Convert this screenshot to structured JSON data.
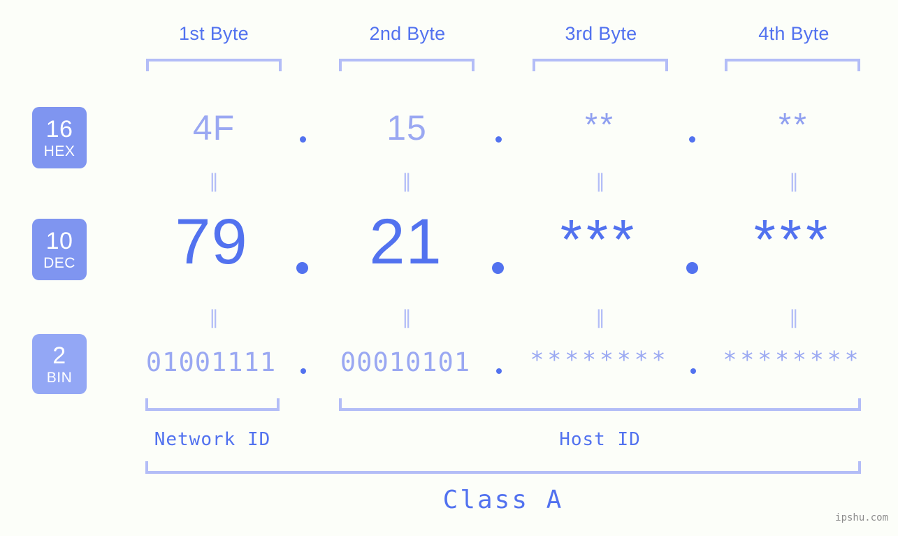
{
  "page": {
    "background": "#fcfef9",
    "accent_strong": "#5272ef",
    "accent_light": "#9aa8f2",
    "accent_pale": "#b3bdf7",
    "watermark": "ipshu.com"
  },
  "columns": [
    {
      "header": "1st Byte"
    },
    {
      "header": "2nd Byte"
    },
    {
      "header": "3rd Byte"
    },
    {
      "header": "4th Byte"
    }
  ],
  "bases": [
    {
      "number": "16",
      "name": "HEX",
      "color": "#7f95f0"
    },
    {
      "number": "10",
      "name": "DEC",
      "color": "#7f95f0"
    },
    {
      "number": "2",
      "name": "BIN",
      "color": "#93a7f5"
    }
  ],
  "rows": {
    "hex": {
      "base_number": "16",
      "base_name": "HEX",
      "values": [
        "4F",
        "15",
        "**",
        "**"
      ],
      "separator": "."
    },
    "dec": {
      "base_number": "10",
      "base_name": "DEC",
      "values": [
        "79",
        "21",
        "***",
        "***"
      ],
      "separator": "."
    },
    "bin": {
      "base_number": "2",
      "base_name": "BIN",
      "values": [
        "01001111",
        "00010101",
        "********",
        "********"
      ],
      "separator": "."
    }
  },
  "equals_marks": {
    "symbol": "‖",
    "count_per_gap": 4
  },
  "footer": {
    "network_id_label": "Network ID",
    "host_id_label": "Host ID",
    "class_label": "Class A"
  }
}
